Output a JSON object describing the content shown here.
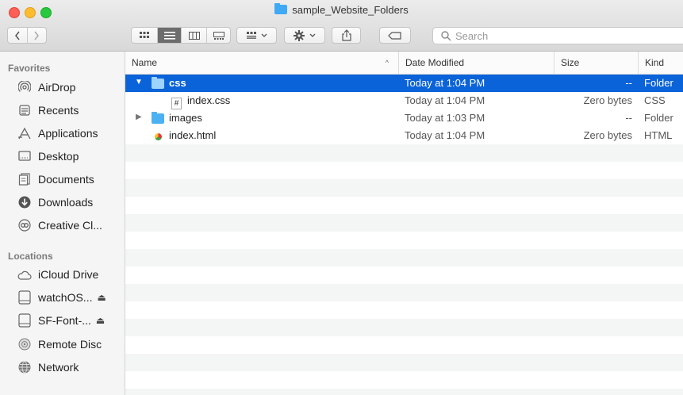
{
  "window": {
    "title": "sample_Website_Folders"
  },
  "toolbar": {
    "search_placeholder": "Search"
  },
  "sidebar": {
    "favorites_heading": "Favorites",
    "favorites": [
      {
        "label": "AirDrop",
        "icon": "airdrop-icon"
      },
      {
        "label": "Recents",
        "icon": "recents-icon"
      },
      {
        "label": "Applications",
        "icon": "applications-icon"
      },
      {
        "label": "Desktop",
        "icon": "desktop-icon"
      },
      {
        "label": "Documents",
        "icon": "documents-icon"
      },
      {
        "label": "Downloads",
        "icon": "downloads-icon"
      },
      {
        "label": "Creative Cl...",
        "icon": "creative-cloud-icon"
      }
    ],
    "locations_heading": "Locations",
    "locations": [
      {
        "label": "iCloud Drive",
        "icon": "icloud-icon"
      },
      {
        "label": "watchOS...",
        "icon": "disk-icon",
        "eject": true
      },
      {
        "label": "SF-Font-...",
        "icon": "disk-icon",
        "eject": true
      },
      {
        "label": "Remote Disc",
        "icon": "remote-disc-icon"
      },
      {
        "label": "Network",
        "icon": "network-icon"
      }
    ]
  },
  "columns": {
    "name": "Name",
    "date": "Date Modified",
    "size": "Size",
    "kind": "Kind"
  },
  "rows": [
    {
      "name": "css",
      "date": "Today at 1:04 PM",
      "size": "--",
      "kind": "Folder",
      "selected": true
    },
    {
      "name": "index.css",
      "date": "Today at 1:04 PM",
      "size": "Zero bytes",
      "kind": "CSS"
    },
    {
      "name": "images",
      "date": "Today at 1:03 PM",
      "size": "--",
      "kind": "Folder"
    },
    {
      "name": "index.html",
      "date": "Today at 1:04 PM",
      "size": "Zero bytes",
      "kind": "HTML"
    }
  ],
  "colors": {
    "selection": "#0a63d8",
    "folder": "#4bb1f3"
  }
}
